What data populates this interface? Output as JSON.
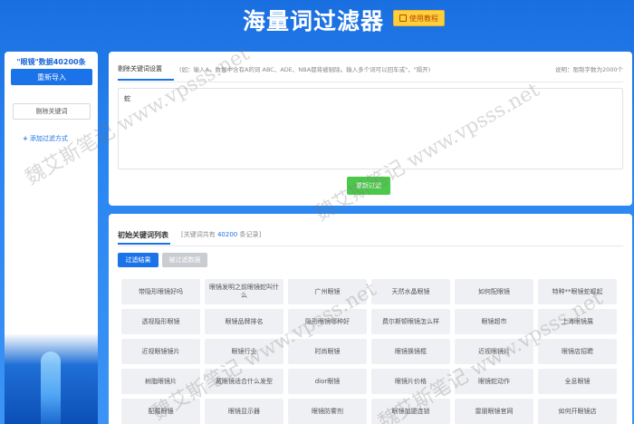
{
  "header": {
    "title": "海量词过滤器",
    "tutorial_label": "使用教程"
  },
  "sidebar": {
    "data_count": "\"眼镜\"数据40200条",
    "reimport_label": "重新导入",
    "remove_keyword_label": "剔除关键词",
    "add_filter_label": "添加过滤方式"
  },
  "filter": {
    "tab_label": "剔除关键词设置",
    "hint": "(如：输入A，数据中含有A的词 ABC、ADE、NBA都将被剔除。输入多个词可以回车或\"，\"隔开)",
    "note": "说明：限制字数为2000个",
    "textarea_value": "蛇",
    "refilter_label": "重新过滤"
  },
  "list": {
    "title": "初始关键词列表",
    "total_prefix": "[关键词共有",
    "total_count": "40200",
    "total_suffix": "条记录]",
    "result_btn": "过滤结果",
    "filtered_btn": "被过滤数据",
    "keywords": [
      "带隐形眼镜好吗",
      "眼镜发明之前眼镜蛇叫什么",
      "广州眼镜",
      "天然水晶眼镜",
      "如何配眼镜",
      "特种**眼镜蛇崛起",
      "透视隐形眼镜",
      "眼镜品牌排名",
      "隐形眼镜哪种好",
      "费尔斯顿眼镜怎么样",
      "眼镜超市",
      "上海眼镜展",
      "近视眼镜镜片",
      "眼镜行业",
      "时尚眼镜",
      "眼镜换镜框",
      "近视眼镜片",
      "眼镜店招聘",
      "树脂眼镜片",
      "戴眼镜适合什么发型",
      "dior眼镜",
      "眼镜片价格",
      "眼镜蛇动作",
      "全息眼镜",
      "配戴眼镜",
      "眼镜显示器",
      "眼镜防雾剂",
      "眼镜加盟连锁",
      "雷朋眼镜官网",
      "如何开眼镜店"
    ]
  },
  "watermark": "魏艾斯笔记 www.vpsss.net"
}
